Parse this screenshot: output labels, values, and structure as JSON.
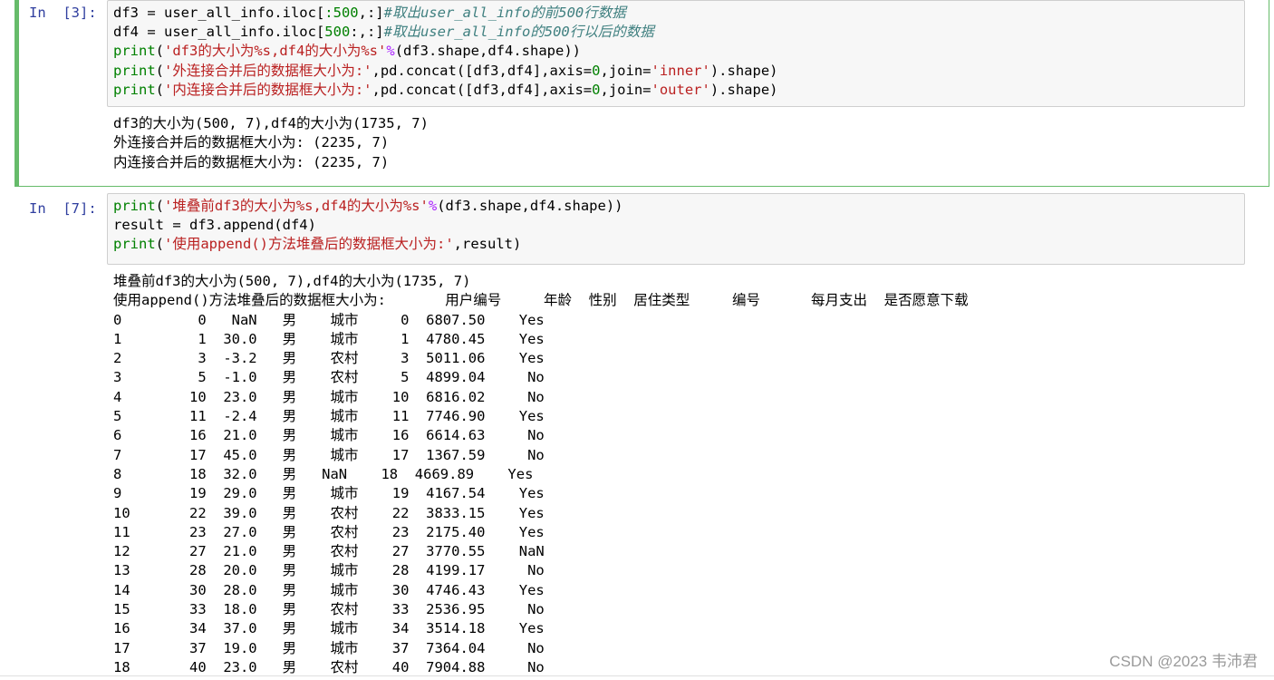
{
  "cells": [
    {
      "prompt": "In  [3]:",
      "code_lines": [
        [
          [
            "",
            "df3 = user_all_info.iloc["
          ],
          [
            "num",
            ":500"
          ],
          [
            "",
            ",:]"
          ],
          [
            "cmt",
            "#取出user_all_info的前500行数据"
          ]
        ],
        [
          [
            "",
            "df4 = user_all_info.iloc["
          ],
          [
            "num",
            "500"
          ],
          [
            "",
            ":,:]"
          ],
          [
            "cmt",
            "#取出user_all_info的500行以后的数据"
          ]
        ],
        [
          [
            "kw",
            "print"
          ],
          [
            "",
            "("
          ],
          [
            "str",
            "'df3的大小为%s,df4的大小为%s'"
          ],
          [
            "op",
            "%"
          ],
          [
            "",
            "(df3.shape,df4.shape))"
          ]
        ],
        [
          [
            "kw",
            "print"
          ],
          [
            "",
            "("
          ],
          [
            "str",
            "'外连接合并后的数据框大小为:'"
          ],
          [
            "",
            ",pd.concat([df3,df4],axis="
          ],
          [
            "num",
            "0"
          ],
          [
            "",
            ",join="
          ],
          [
            "str",
            "'inner'"
          ],
          [
            "",
            ").shape)"
          ]
        ],
        [
          [
            "kw",
            "print"
          ],
          [
            "",
            "("
          ],
          [
            "str",
            "'内连接合并后的数据框大小为:'"
          ],
          [
            "",
            ",pd.concat([df3,df4],axis="
          ],
          [
            "num",
            "0"
          ],
          [
            "",
            ",join="
          ],
          [
            "str",
            "'outer'"
          ],
          [
            "",
            ").shape)"
          ]
        ]
      ],
      "output_lines": [
        "df3的大小为(500, 7),df4的大小为(1735, 7)",
        "外连接合并后的数据框大小为: (2235, 7)",
        "内连接合并后的数据框大小为: (2235, 7)"
      ]
    },
    {
      "prompt": "In  [7]:",
      "code_lines": [
        [
          [
            "kw",
            "print"
          ],
          [
            "",
            "("
          ],
          [
            "str",
            "'堆叠前df3的大小为%s,df4的大小为%s'"
          ],
          [
            "op",
            "%"
          ],
          [
            "",
            "(df3.shape,df4.shape))"
          ]
        ],
        [
          [
            "",
            "result = df3.append(df4)"
          ]
        ],
        [
          [
            "kw",
            "print"
          ],
          [
            "",
            "("
          ],
          [
            "str",
            "'使用append()方法堆叠后的数据框大小为:'"
          ],
          [
            "",
            ",result)"
          ]
        ]
      ],
      "output_lines": [
        "堆叠前df3的大小为(500, 7),df4的大小为(1735, 7)",
        "使用append()方法堆叠后的数据框大小为:       用户编号     年龄  性别  居住类型     编号      每月支出  是否愿意下载",
        "0         0   NaN   男    城市     0  6807.50    Yes",
        "1         1  30.0   男    城市     1  4780.45    Yes",
        "2         3  -3.2   男    农村     3  5011.06    Yes",
        "3         5  -1.0   男    农村     5  4899.04     No",
        "4        10  23.0   男    城市    10  6816.02     No",
        "5        11  -2.4   男    城市    11  7746.90    Yes",
        "6        16  21.0   男    城市    16  6614.63     No",
        "7        17  45.0   男    城市    17  1367.59     No",
        "8        18  32.0   男   NaN    18  4669.89    Yes",
        "9        19  29.0   男    城市    19  4167.54    Yes",
        "10       22  39.0   男    农村    22  3833.15    Yes",
        "11       23  27.0   男    农村    23  2175.40    Yes",
        "12       27  21.0   男    农村    27  3770.55    NaN",
        "13       28  20.0   男    城市    28  4199.17     No",
        "14       30  28.0   男    城市    30  4746.43    Yes",
        "15       33  18.0   男    农村    33  2536.95     No",
        "16       34  37.0   男    城市    34  3514.18    Yes",
        "17       37  19.0   男    城市    37  7364.04     No",
        "18       40  23.0   男    农村    40  7904.88     No"
      ]
    }
  ],
  "watermark": "CSDN @2023 韦沛君"
}
